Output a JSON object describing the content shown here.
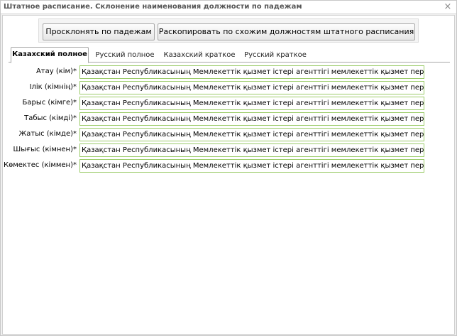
{
  "window": {
    "title": "Штатное расписание. Склонение наименования должности по падежам",
    "close_glyph": "×"
  },
  "toolbar": {
    "decline_label": "Просклонять по падежам",
    "copy_label": "Раскопировать по схожим должностям штатного расписания"
  },
  "tabs": [
    {
      "label": "Казахский полное",
      "active": true
    },
    {
      "label": "Русский полное",
      "active": false
    },
    {
      "label": "Казахский краткое",
      "active": false
    },
    {
      "label": "Русский краткое",
      "active": false
    }
  ],
  "fields": [
    {
      "label": "Атау (кім)*",
      "value": "Қазақстан Республикасының Мемлекеттік қызмет істері агенттігі мемлекеттік қызмет персоналын басқару"
    },
    {
      "label": "Ілік (кімнің)*",
      "value": "Қазақстан Республикасының Мемлекеттік қызмет істері агенттігі мемлекеттік қызмет персоналын басқару"
    },
    {
      "label": "Барыс (кімге)*",
      "value": "Қазақстан Республикасының Мемлекеттік қызмет істері агенттігі мемлекеттік қызмет персоналын басқару"
    },
    {
      "label": "Табыс (кімді)*",
      "value": "Қазақстан Республикасының Мемлекеттік қызмет істері агенттігі мемлекеттік қызмет персоналын басқару"
    },
    {
      "label": "Жатыс (кімде)*",
      "value": "Қазақстан Республикасының Мемлекеттік қызмет істері агенттігі мемлекеттік қызмет персоналын басқару"
    },
    {
      "label": "Шығыс (кімнен)*",
      "value": "Қазақстан Республикасының Мемлекеттік қызмет істері агенттігі мемлекеттік қызмет персоналын басқару"
    },
    {
      "label": "Көмектес (кіммен)*",
      "value": "Қазақстан Республикасының Мемлекеттік қызмет істері агенттігі мемлекеттік қызмет персоналын басқару"
    }
  ]
}
